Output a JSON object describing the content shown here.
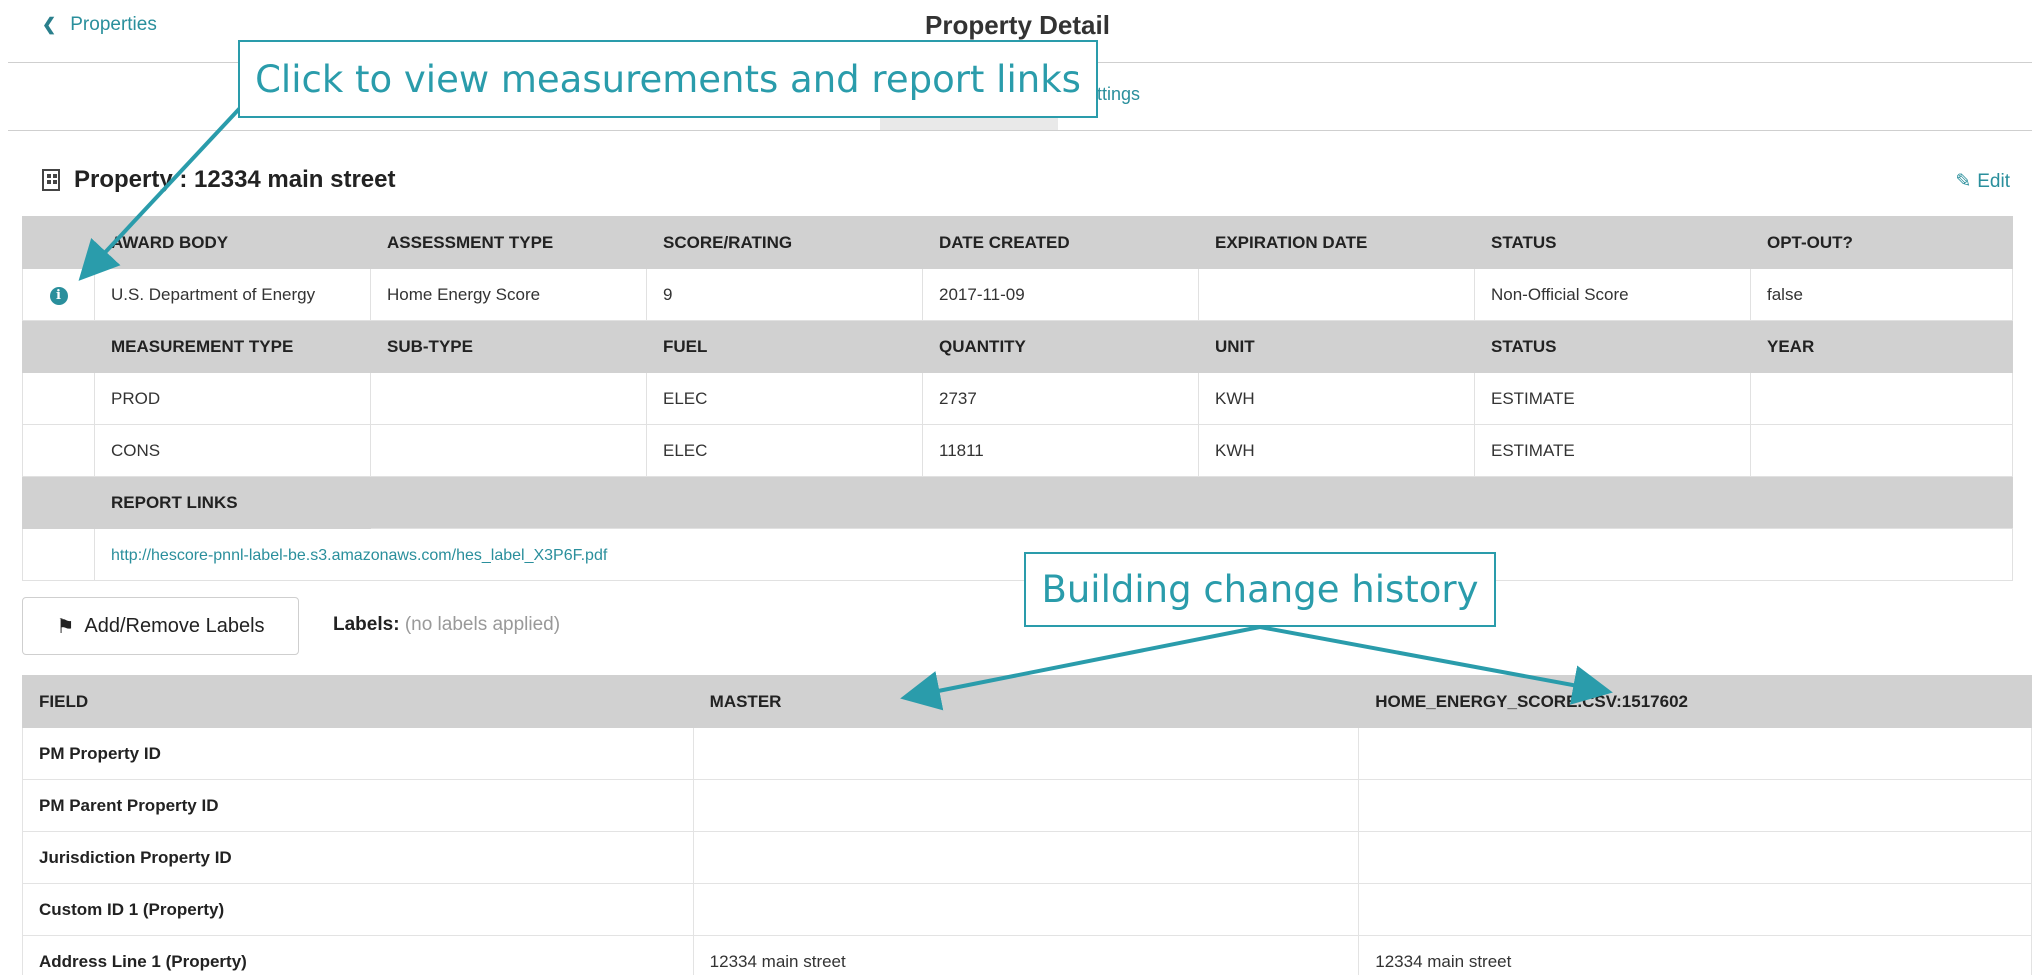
{
  "header": {
    "back_label": "Properties",
    "title": "Property Detail",
    "tab_settings_partial": "ttings"
  },
  "property": {
    "heading": "Property : 12334 main street",
    "edit_label": "Edit"
  },
  "assessment": {
    "headers": [
      "AWARD BODY",
      "ASSESSMENT TYPE",
      "SCORE/RATING",
      "DATE CREATED",
      "EXPIRATION DATE",
      "STATUS",
      "OPT-OUT?"
    ],
    "row": [
      "U.S. Department of Energy",
      "Home Energy Score",
      "9",
      "2017-11-09",
      "",
      "Non-Official Score",
      "false"
    ]
  },
  "measurements": {
    "headers": [
      "MEASUREMENT TYPE",
      "SUB-TYPE",
      "FUEL",
      "QUANTITY",
      "UNIT",
      "STATUS",
      "YEAR"
    ],
    "rows": [
      [
        "PROD",
        "",
        "ELEC",
        "2737",
        "KWH",
        "ESTIMATE",
        ""
      ],
      [
        "CONS",
        "",
        "ELEC",
        "11811",
        "KWH",
        "ESTIMATE",
        ""
      ]
    ]
  },
  "report_links": {
    "header": "REPORT LINKS",
    "link": "http://hescore-pnnl-label-be.s3.amazonaws.com/hes_label_X3P6F.pdf"
  },
  "labels": {
    "button_label": "Add/Remove Labels",
    "caption": "Labels:",
    "value": "(no labels applied)"
  },
  "history": {
    "headers": [
      "FIELD",
      "MASTER",
      "HOME_ENERGY_SCORE.CSV:1517602"
    ],
    "rows": [
      [
        "PM Property ID",
        "",
        ""
      ],
      [
        "PM Parent Property ID",
        "",
        ""
      ],
      [
        "Jurisdiction Property ID",
        "",
        ""
      ],
      [
        "Custom ID 1 (Property)",
        "",
        ""
      ],
      [
        "Address Line 1 (Property)",
        "12334 main street",
        "12334 main street"
      ]
    ]
  },
  "callouts": {
    "measurements": "Click to view measurements and report links",
    "history": "Building change history"
  },
  "colors": {
    "accent": "#2a8f9c",
    "callout": "#2a9cab",
    "table_header": "#d1d1d1"
  }
}
